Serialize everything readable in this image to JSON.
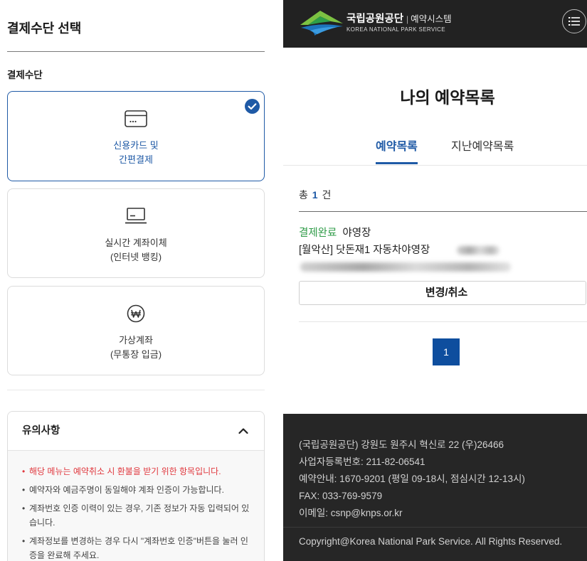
{
  "payment_panel": {
    "title": "결제수단 선택",
    "section_label": "결제수단",
    "selected_icon": "check-circle-icon",
    "methods": [
      {
        "label_line1": "신용카드 및",
        "label_line2": "간편결제",
        "icon": "credit-card-icon",
        "selected": true
      },
      {
        "label_line1": "실시간 계좌이체",
        "label_line2": "(인터넷 뱅킹)",
        "icon": "monitor-icon",
        "selected": false
      },
      {
        "label_line1": "가상계좌",
        "label_line2": "(무통장 입금)",
        "icon": "won-circle-icon",
        "selected": false
      }
    ],
    "notice": {
      "title": "유의사항",
      "expanded": true,
      "toggle_icon": "chevron-up-icon",
      "items": [
        {
          "text": "해당 메뉴는 예약취소 시 환불을 받기 위한 항목입니다.",
          "emphasis": true
        },
        {
          "text": "예약자와 예금주명이 동일해야 계좌 인증이 가능합니다.",
          "emphasis": false
        },
        {
          "text": "계좌번호 인증 이력이 있는 경우, 기존 정보가 자동 입력되어 있습니다.",
          "emphasis": false
        },
        {
          "text": "계좌정보를 변경하는 경우 다시 \"계좌번호 인증\"버튼을 눌러 인증을 완료해 주세요.",
          "emphasis": false
        }
      ]
    }
  },
  "reservation_panel": {
    "header": {
      "logo_icon": "knps-mountain-logo",
      "org_name": "국립공원공단",
      "separator": "|",
      "system_name": "예약시스템",
      "org_name_en": "KOREA NATIONAL PARK SERVICE",
      "menu_icon": "list-menu-icon"
    },
    "page_title": "나의 예약목록",
    "tabs": [
      {
        "label": "예약목록",
        "active": true
      },
      {
        "label": "지난예약목록",
        "active": false
      }
    ],
    "summary": {
      "prefix": "총",
      "count": "1",
      "suffix": "건"
    },
    "reservations": [
      {
        "status": "결제완료",
        "category": "야영장",
        "site": "[월악산] 닷돈재1 자동차야영장",
        "action_label": "변경/취소"
      }
    ],
    "pagination": {
      "current_page": "1"
    },
    "footer": {
      "address": "(국립공원공단) 강원도 원주시 혁신로 22 (우)26466",
      "business_number": "사업자등록번호: 211-82-06541",
      "reservation_info": "예약안내: 1670-9201 (평일 09-18시, 점심시간 12-13시)",
      "fax": "FAX: 033-769-9579",
      "email": "이메일: csnp@knps.or.kr",
      "copyright": "Copyright@Korea National Park Service. All Rights Reserved."
    }
  },
  "colors": {
    "accent_blue": "#1f5aa6",
    "status_green": "#2e9b47",
    "notice_red": "#e0383e",
    "dark_bg": "#222222"
  }
}
